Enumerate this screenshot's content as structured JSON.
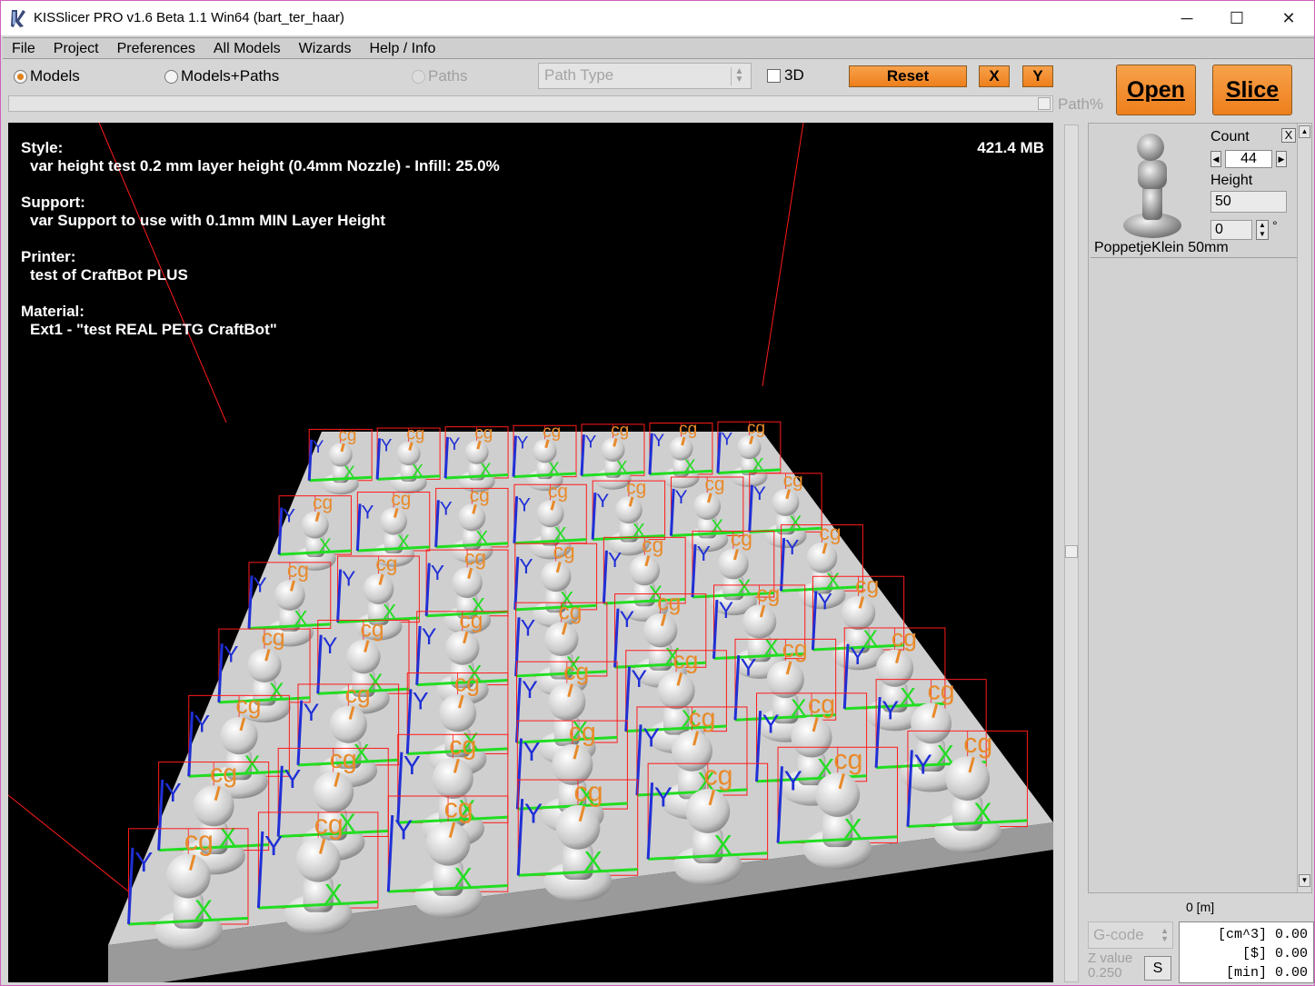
{
  "window": {
    "title": "KISSlicer PRO v1.6 Beta 1.1 Win64 (bart_ter_haar)",
    "minimize": "─",
    "maximize": "☐",
    "close": "✕"
  },
  "menu": [
    "File",
    "Project",
    "Preferences",
    "All Models",
    "Wizards",
    "Help / Info"
  ],
  "toolbar": {
    "view_models": "Models",
    "view_models_paths": "Models+Paths",
    "view_paths": "Paths",
    "path_type_placeholder": "Path Type",
    "check_3d": "3D",
    "reset": "Reset",
    "x": "X",
    "y": "Y",
    "open": "Open",
    "slice": "Slice",
    "path_pct_label": "Path%"
  },
  "viewport": {
    "style_label": "Style:",
    "style_value": "var height test 0.2 mm layer height (0.4mm Nozzle) - Infill: 25.0%",
    "support_label": "Support:",
    "support_value": "var Support to use with 0.1mm MIN Layer Height",
    "printer_label": "Printer:",
    "printer_value": "test of CraftBot PLUS",
    "material_label": "Material:",
    "material_value": "Ext1 - \"test REAL PETG CraftBot\"",
    "memory": "421.4 MB",
    "axis_x": "X",
    "axis_y": "Y",
    "cg": "cg"
  },
  "model_panel": {
    "count_label": "Count",
    "count_value": "44",
    "remove": "X",
    "height_label": "Height",
    "height_value": "50",
    "rotation_value": "0",
    "degree": "°",
    "model_name": "PoppetjeKlein 50mm"
  },
  "footer": {
    "distance": "0 [m]",
    "gcode_select": "G-code",
    "z_value_label": "Z value",
    "z_value": "0.250",
    "s_button": "S",
    "stats": [
      {
        "unit": "[cm^3]",
        "value": "0.00"
      },
      {
        "unit": "[$]",
        "value": "0.00"
      },
      {
        "unit": "[min]",
        "value": "0.00"
      }
    ]
  },
  "colors": {
    "accent_orange": "#ee7f1c",
    "axis_x": "#22dd22",
    "axis_y": "#1f2fd6",
    "cg_label": "#e88a2a",
    "bbox": "#ff1a1a"
  },
  "icons": {
    "app": "kisslicer-app-icon",
    "model": "figurine-thumbnail"
  }
}
